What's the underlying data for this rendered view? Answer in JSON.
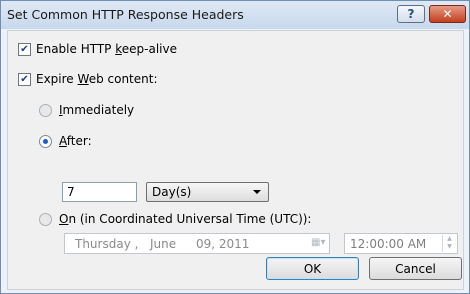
{
  "window": {
    "title": "Set Common HTTP Response Headers",
    "help_glyph": "?",
    "close_glyph": "✕"
  },
  "keep_alive": {
    "checked": true,
    "pre": "Enable HTTP ",
    "accel": "k",
    "post": "eep-alive"
  },
  "expire": {
    "checked": true,
    "pre": "Expire ",
    "accel": "W",
    "post": "eb content:"
  },
  "immediately": {
    "selected": false,
    "accel": "I",
    "post": "mmediately"
  },
  "after": {
    "selected": true,
    "accel": "A",
    "post": "fter:",
    "value": "7",
    "unit": "Day(s)"
  },
  "on_utc": {
    "selected": false,
    "accel": "O",
    "post": "n (in Coordinated Universal Time (UTC)):",
    "date_weekday": "Thursday ,",
    "date_month": "June",
    "date_dayyear": "09, 2011",
    "time": "12:00:00 AM"
  },
  "buttons": {
    "ok": "OK",
    "cancel": "Cancel"
  },
  "colors": {
    "accent": "#1d5bc9",
    "close": "#c2401f"
  }
}
